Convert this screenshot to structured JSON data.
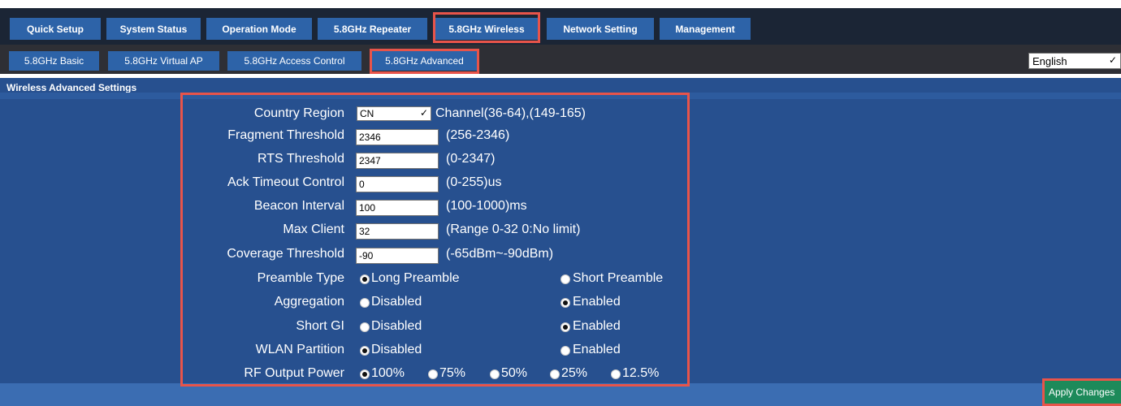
{
  "nav": {
    "tabs": [
      {
        "label": "Quick Setup"
      },
      {
        "label": "System Status"
      },
      {
        "label": "Operation Mode"
      },
      {
        "label": "5.8GHz Repeater"
      },
      {
        "label": "5.8GHz Wireless"
      },
      {
        "label": "Network Setting"
      },
      {
        "label": "Management"
      }
    ],
    "subtabs": [
      {
        "label": "5.8GHz Basic"
      },
      {
        "label": "5.8GHz Virtual AP"
      },
      {
        "label": "5.8GHz Access Control"
      },
      {
        "label": "5.8GHz Advanced"
      }
    ],
    "language": "English"
  },
  "section_title": "Wireless Advanced Settings",
  "form": {
    "country_region": {
      "label": "Country Region",
      "value": "CN",
      "hint": "Channel(36-64),(149-165)"
    },
    "fragment_threshold": {
      "label": "Fragment Threshold",
      "value": "2346",
      "hint": "(256-2346)"
    },
    "rts_threshold": {
      "label": "RTS Threshold",
      "value": "2347",
      "hint": "(0-2347)"
    },
    "ack_timeout": {
      "label": "Ack Timeout Control",
      "value": "0",
      "hint": "(0-255)us"
    },
    "beacon_interval": {
      "label": "Beacon Interval",
      "value": "100",
      "hint": "(100-1000)ms"
    },
    "max_client": {
      "label": "Max Client",
      "value": "32",
      "hint": "(Range 0-32 0:No limit)"
    },
    "coverage_threshold": {
      "label": "Coverage Threshold",
      "value": "-90",
      "hint": "(-65dBm~-90dBm)"
    },
    "preamble_type": {
      "label": "Preamble Type",
      "options": [
        "Long Preamble",
        "Short Preamble"
      ],
      "selected": "Long Preamble"
    },
    "aggregation": {
      "label": "Aggregation",
      "options": [
        "Disabled",
        "Enabled"
      ],
      "selected": "Enabled"
    },
    "short_gi": {
      "label": "Short GI",
      "options": [
        "Disabled",
        "Enabled"
      ],
      "selected": "Enabled"
    },
    "wlan_partition": {
      "label": "WLAN Partition",
      "options": [
        "Disabled",
        "Enabled"
      ],
      "selected": "Disabled"
    },
    "rf_output_power": {
      "label": "RF Output Power",
      "options": [
        "100%",
        "75%",
        "50%",
        "25%",
        "12.5%"
      ],
      "selected": "100%"
    }
  },
  "apply_label": "Apply Changes",
  "colors": {
    "highlight": "#e8544a",
    "tab": "#2d63a8",
    "content": "#27508f",
    "apply": "#1d8a5a"
  }
}
